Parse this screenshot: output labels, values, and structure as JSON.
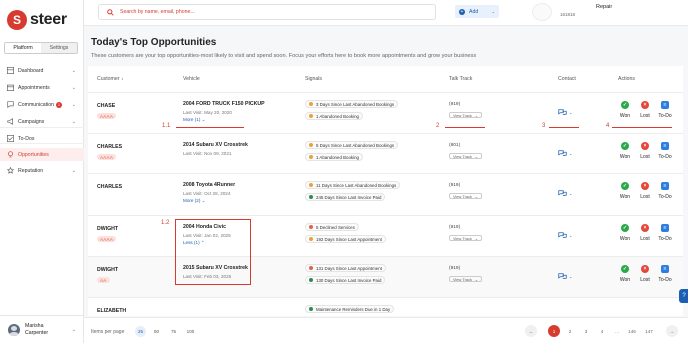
{
  "app": {
    "brand": "steer"
  },
  "sidebar": {
    "tabs": [
      {
        "label": "Platform",
        "active": true
      },
      {
        "label": "Settings",
        "active": false
      }
    ],
    "items": [
      {
        "label": "Dashboard",
        "icon": "dashboard-icon"
      },
      {
        "label": "Appointments",
        "icon": "calendar-icon"
      },
      {
        "label": "Communication",
        "icon": "chat-icon",
        "badge": "1"
      },
      {
        "label": "Campaigns",
        "icon": "megaphone-icon"
      },
      {
        "label": "To-Dos",
        "icon": "checklist-icon"
      },
      {
        "label": "Opportunities",
        "icon": "lightbulb-icon",
        "active": true
      },
      {
        "label": "Reputation",
        "icon": "star-icon"
      }
    ],
    "user": {
      "first": "Marisha",
      "last": "Carpenter"
    }
  },
  "topbar": {
    "search_placeholder": "Search by name, email, phone...",
    "add_label": "Add",
    "account_sub": "161818",
    "account_name": "Repair"
  },
  "page": {
    "title": "Today's Top Opportunities",
    "subtitle": "These customers are your top opportunities-most likely to visit and spend soon. Focus your efforts here to book more appointments and grow your business"
  },
  "table": {
    "headers": {
      "customer": "Customer",
      "customer_sort": "↓",
      "vehicle": "Vehicle",
      "signals": "Signals",
      "talk": "Talk Track",
      "contact": "Contact",
      "actions": "Actions"
    },
    "view_track": "View Track",
    "actions": {
      "won": "Won",
      "lost": "Lost",
      "todo": "To-Do"
    },
    "rows": [
      {
        "name": "CHASE",
        "stars": "AAAA",
        "vehicle": "2004 FORD TRUCK F150 PICKUP",
        "last_visit": "Last Visit: May 20, 2020",
        "more": "More (1)",
        "signals": [
          {
            "text": "3 Days Since Last Abandoned Bookings",
            "color": "#e8a33b"
          },
          {
            "text": "1 Abandoned Booking",
            "color": "#e8a33b"
          }
        ],
        "talk": "(919)"
      },
      {
        "name": "CHARLES",
        "stars": "AAAA",
        "vehicle": "2014 Subaru XV Crosstrek",
        "last_visit": "Last Visit: Nov 09, 2021",
        "more": "",
        "signals": [
          {
            "text": "5 Days Since Last Abandoned Bookings",
            "color": "#e8a33b"
          },
          {
            "text": "1 Abandoned Booking",
            "color": "#e8a33b"
          }
        ],
        "talk": "(801)"
      },
      {
        "name": "CHARLES",
        "stars": "",
        "vehicle": "2008 Toyota 4Runner",
        "last_visit": "Last Visit: Oct 28, 2024",
        "more": "More (2)",
        "signals": [
          {
            "text": "11 Days Since Last Abandoned Bookings",
            "color": "#e8a33b"
          },
          {
            "text": "245 Days Since Last Invoice Paid",
            "color": "#2e8b57"
          }
        ],
        "talk": "(919)"
      },
      {
        "name": "DWIGHT",
        "stars": "AAAA",
        "vehicle": "2004 Honda Civic",
        "last_visit": "Last Visit: Jan 02, 2025",
        "more": "Less (1)",
        "signals": [
          {
            "text": "5 Declined Services",
            "color": "#e5614f"
          },
          {
            "text": "192 Days Since Last Appointment",
            "color": "#e8a33b"
          }
        ],
        "talk": "(919)"
      },
      {
        "name": "DWIGHT",
        "stars": "AA",
        "vehicle": "2015 Subaru XV Crosstrek",
        "last_visit": "Last Visit: Feb 03, 2025",
        "more": "",
        "signals": [
          {
            "text": "131 Days Since Last Appointment",
            "color": "#e5614f"
          },
          {
            "text": "130 Days Since Last Invoice Paid",
            "color": "#2e8b57"
          }
        ],
        "talk": "(919)"
      },
      {
        "name": "ELIZABETH",
        "stars": "",
        "vehicle": "",
        "last_visit": "",
        "more": "",
        "signals": [
          {
            "text": "Maintenance Reminders Due in 1 Day",
            "color": "#2e8b57"
          }
        ],
        "talk": ""
      }
    ]
  },
  "annotations": {
    "a1": "1.1",
    "a2": "2",
    "a3": "3",
    "a4": "4",
    "a12": "1.2"
  },
  "pager": {
    "items_label": "Items per page",
    "per_page": [
      "25",
      "50",
      "75",
      "100"
    ],
    "pages": [
      "1",
      "2",
      "3",
      "4",
      "...",
      "146",
      "147"
    ],
    "prev": "←",
    "next": "→"
  },
  "help": "?"
}
